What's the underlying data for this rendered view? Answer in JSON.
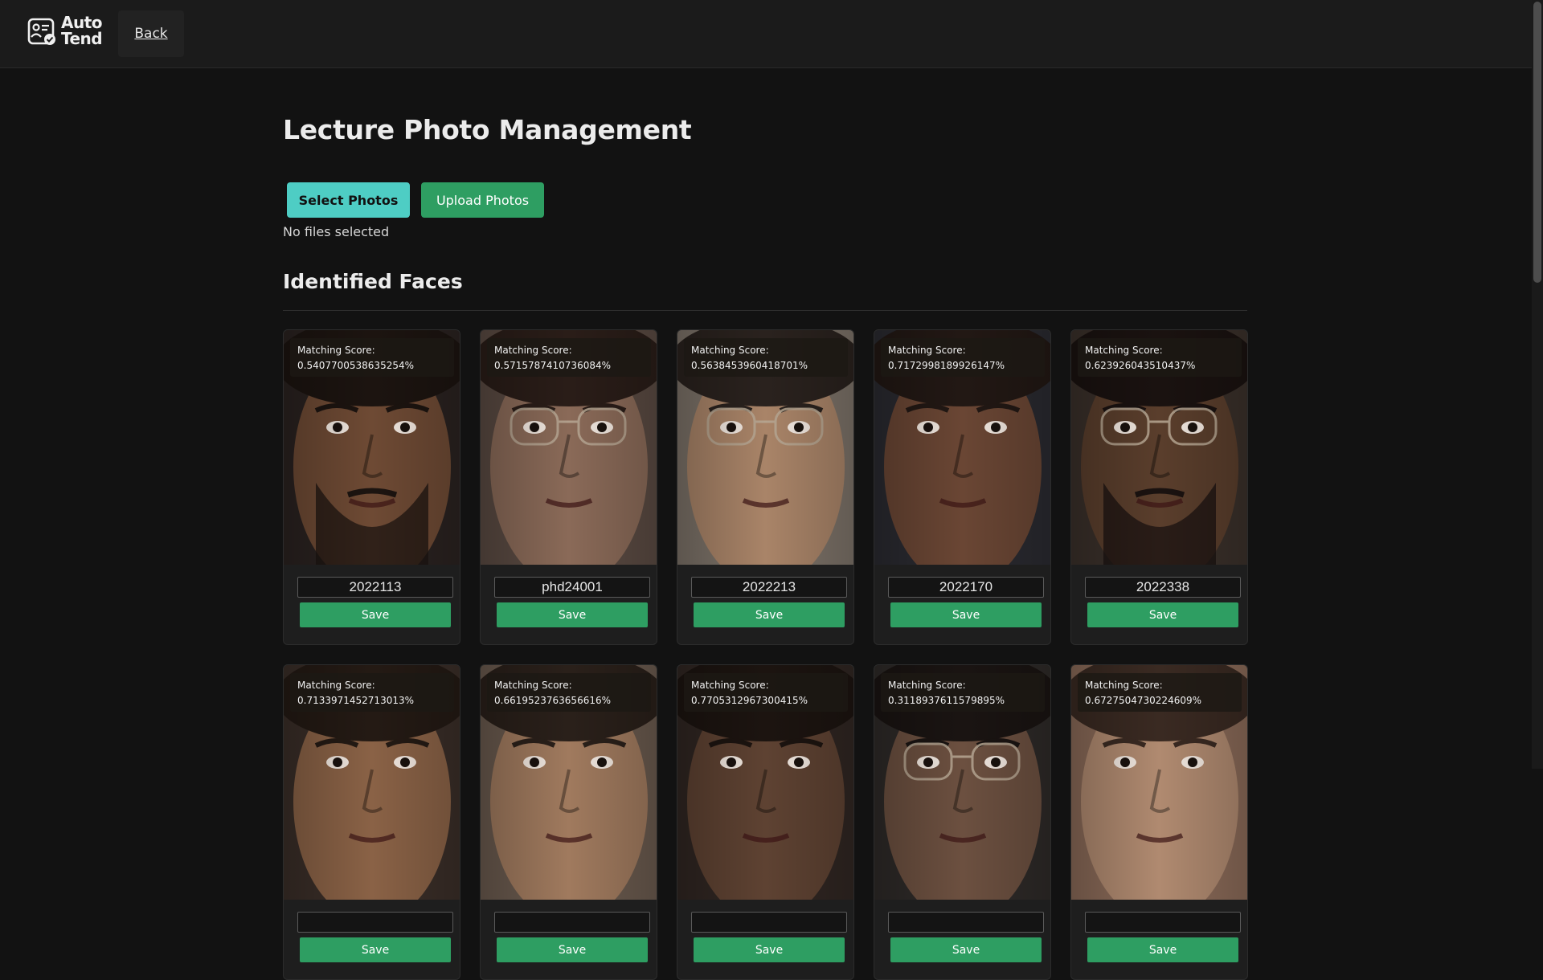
{
  "app": {
    "logo_line1": "Auto",
    "logo_line2": "Tend",
    "back_label": "Back"
  },
  "page": {
    "title": "Lecture Photo Management",
    "select_label": "Select Photos",
    "upload_label": "Upload Photos",
    "file_status": "No files selected",
    "section_title": "Identified Faces",
    "score_label": "Matching Score:",
    "save_label": "Save"
  },
  "faces": [
    {
      "score": "0.5407700538635254%",
      "student_id": "2022113",
      "skin": "#6e4a34",
      "hair": "#1c1410",
      "bg": "#2a2220",
      "glasses": false,
      "beard": true
    },
    {
      "score": "0.5715787410736084%",
      "student_id": "phd24001",
      "skin": "#8a6a58",
      "hair": "#2a1d18",
      "bg": "#5a4a42",
      "glasses": true,
      "beard": false
    },
    {
      "score": "0.5638453960418701%",
      "student_id": "2022213",
      "skin": "#a98468",
      "hair": "#2a221e",
      "bg": "#7c7268",
      "glasses": true,
      "beard": false
    },
    {
      "score": "0.7172998189926147%",
      "student_id": "2022170",
      "skin": "#6a4634",
      "hair": "#221814",
      "bg": "#2a2a30",
      "glasses": false,
      "beard": false
    },
    {
      "score": "0.623926043510437%",
      "student_id": "2022338",
      "skin": "#5a3e2c",
      "hair": "#1a1210",
      "bg": "#3a302a",
      "glasses": true,
      "beard": true
    },
    {
      "score": "0.7133971452713013%",
      "student_id": "",
      "skin": "#8a6246",
      "hair": "#241a14",
      "bg": "#3a2e28",
      "glasses": false,
      "beard": false
    },
    {
      "score": "0.6619523763656616%",
      "student_id": "",
      "skin": "#a07a5e",
      "hair": "#2a201a",
      "bg": "#6a5a4e",
      "glasses": false,
      "beard": false
    },
    {
      "score": "0.7705312967300415%",
      "student_id": "",
      "skin": "#5e4232",
      "hair": "#1c1410",
      "bg": "#302622",
      "glasses": false,
      "beard": false
    },
    {
      "score": "0.3118937611579895%",
      "student_id": "",
      "skin": "#6c5040",
      "hair": "#1a1412",
      "bg": "#2e2a28",
      "glasses": true,
      "beard": false
    },
    {
      "score": "0.6727504730224609%",
      "student_id": "",
      "skin": "#b08a70",
      "hair": "#3a2a22",
      "bg": "#8a6a58",
      "glasses": false,
      "beard": false
    }
  ]
}
